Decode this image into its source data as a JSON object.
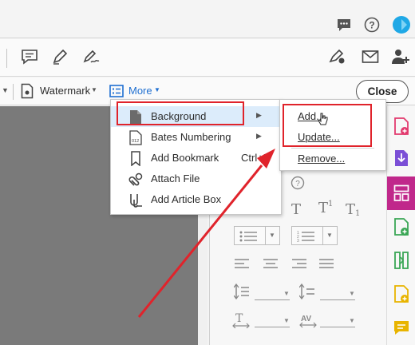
{
  "toolbar": {
    "watermark_label": "Watermark",
    "more_label": "More",
    "close_label": "Close"
  },
  "more_menu": {
    "items": [
      {
        "label": "Background",
        "icon": "page-icon",
        "has_submenu": true,
        "highlighted": true
      },
      {
        "label": "Bates Numbering",
        "icon": "bates-number-icon",
        "has_submenu": true
      },
      {
        "label": "Add Bookmark",
        "icon": "bookmark-icon",
        "shortcut": "Ctrl+B"
      },
      {
        "label": "Attach File",
        "icon": "paperclip-icon"
      },
      {
        "label": "Add Article Box",
        "icon": "article-box-icon"
      }
    ]
  },
  "background_submenu": {
    "items": [
      {
        "label": "Add...",
        "highlighted": true
      },
      {
        "label": "Update..."
      },
      {
        "label": "Remove..."
      }
    ]
  },
  "annotation": {
    "color": "#e0232b"
  },
  "colors": {
    "brand_blue": "#2d7de0",
    "organize_magenta": "#c0288b",
    "export_purple": "#7b4fd6",
    "green": "#3aa655",
    "yellow": "#e8b400",
    "pink": "#e23a6e",
    "highlight": "#dcecfb"
  }
}
